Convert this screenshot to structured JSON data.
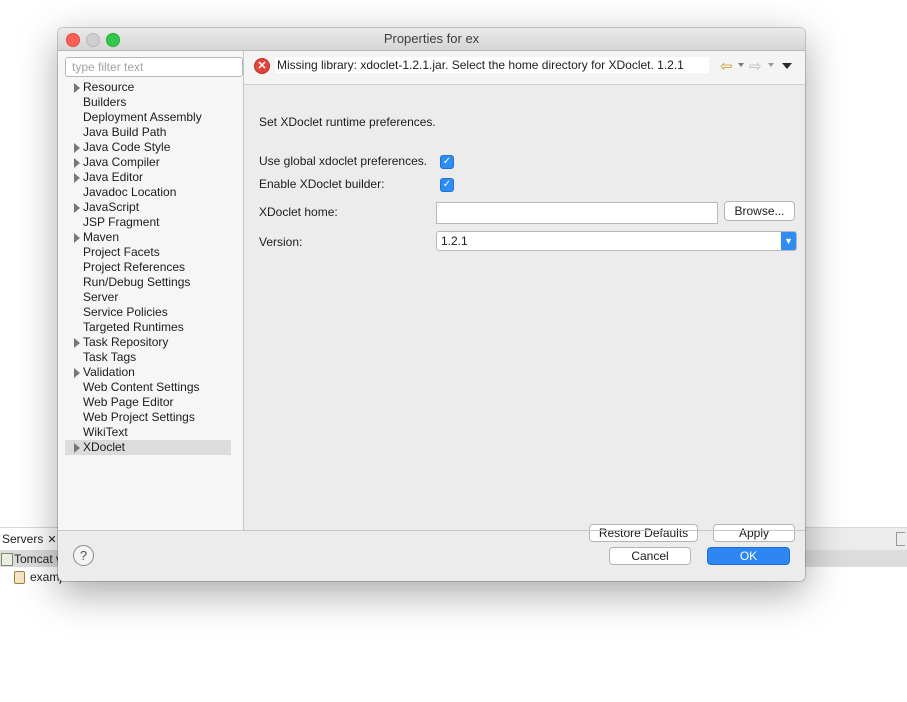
{
  "background": {
    "servers_tab": "Servers",
    "server_row": "Tomcat v",
    "project_row": "examj"
  },
  "dialog": {
    "title": "Properties for ex",
    "filter_placeholder": "type filter text",
    "tree": [
      {
        "label": "Resource",
        "expandable": true
      },
      {
        "label": "Builders",
        "expandable": false
      },
      {
        "label": "Deployment Assembly",
        "expandable": false
      },
      {
        "label": "Java Build Path",
        "expandable": false
      },
      {
        "label": "Java Code Style",
        "expandable": true
      },
      {
        "label": "Java Compiler",
        "expandable": true
      },
      {
        "label": "Java Editor",
        "expandable": true
      },
      {
        "label": "Javadoc Location",
        "expandable": false
      },
      {
        "label": "JavaScript",
        "expandable": true
      },
      {
        "label": "JSP Fragment",
        "expandable": false
      },
      {
        "label": "Maven",
        "expandable": true
      },
      {
        "label": "Project Facets",
        "expandable": false
      },
      {
        "label": "Project References",
        "expandable": false
      },
      {
        "label": "Run/Debug Settings",
        "expandable": false
      },
      {
        "label": "Server",
        "expandable": false
      },
      {
        "label": "Service Policies",
        "expandable": false
      },
      {
        "label": "Targeted Runtimes",
        "expandable": false
      },
      {
        "label": "Task Repository",
        "expandable": true
      },
      {
        "label": "Task Tags",
        "expandable": false
      },
      {
        "label": "Validation",
        "expandable": true
      },
      {
        "label": "Web Content Settings",
        "expandable": false
      },
      {
        "label": "Web Page Editor",
        "expandable": false
      },
      {
        "label": "Web Project Settings",
        "expandable": false
      },
      {
        "label": "WikiText",
        "expandable": false
      },
      {
        "label": "XDoclet",
        "expandable": true,
        "selected": true
      }
    ],
    "error_message": "Missing library: xdoclet-1.2.1.jar. Select the home directory for XDoclet. 1.2.1",
    "description": "Set XDoclet runtime preferences.",
    "use_global_label": "Use global xdoclet preferences.",
    "use_global_checked": true,
    "enable_builder_label": "Enable XDoclet builder:",
    "enable_builder_checked": true,
    "home_label": "XDoclet home:",
    "home_value": "",
    "browse_label": "Browse...",
    "version_label": "Version:",
    "version_value": "1.2.1",
    "restore_defaults_label": "Restore Defaults",
    "apply_label": "Apply",
    "cancel_label": "Cancel",
    "ok_label": "OK",
    "accent_color": "#2f8cf2",
    "error_color": "#e0443a"
  }
}
